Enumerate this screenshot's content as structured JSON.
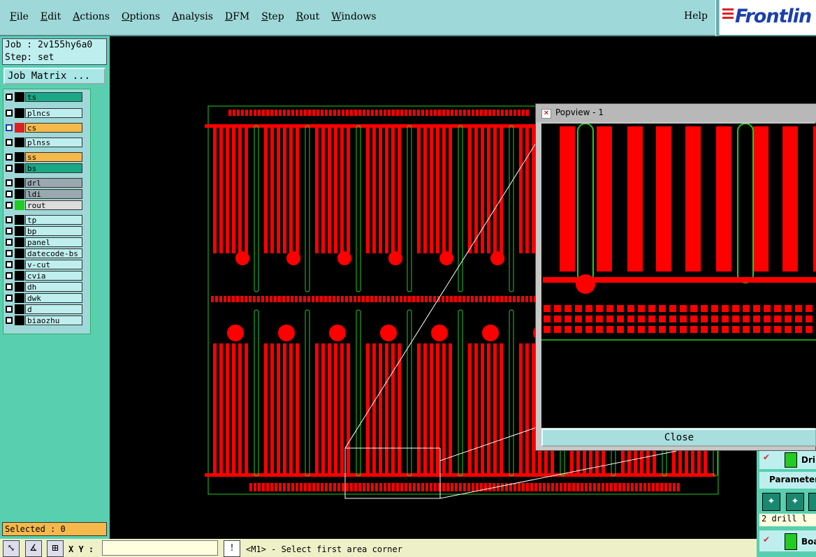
{
  "menu": {
    "items": [
      "File",
      "Edit",
      "Actions",
      "Options",
      "Analysis",
      "DFM",
      "Step",
      "Rout",
      "Windows"
    ],
    "help": "Help"
  },
  "logo": {
    "text": "Frontlin"
  },
  "job": {
    "job_line": "Job : 2v155hy6a0",
    "step_line": "Step: set",
    "matrix_button": "Job Matrix ..."
  },
  "layers": [
    {
      "name": "ts",
      "bg": "#1aa886",
      "swatch": "#000"
    },
    {
      "name": "plncs",
      "bg": "#bfeeee",
      "swatch": "#000"
    },
    {
      "name": "cs",
      "bg": "#f5b84a",
      "swatch": "#e02020",
      "active": true
    },
    {
      "name": "plnss",
      "bg": "#bfeeee",
      "swatch": "#000"
    },
    {
      "name": "ss",
      "bg": "#f5b84a",
      "swatch": "#000"
    },
    {
      "name": "bs",
      "bg": "#1aa886",
      "swatch": "#000"
    },
    {
      "name": "drl",
      "bg": "#9aa8b0",
      "swatch": "#000"
    },
    {
      "name": "ldi",
      "bg": "#9aa8b0",
      "swatch": "#000"
    },
    {
      "name": "rout",
      "bg": "#dcdcdc",
      "swatch": "#22cc22"
    },
    {
      "name": "tp",
      "bg": "#bfeeee",
      "swatch": "#000"
    },
    {
      "name": "bp",
      "bg": "#bfeeee",
      "swatch": "#000"
    },
    {
      "name": "panel",
      "bg": "#bfeeee",
      "swatch": "#000"
    },
    {
      "name": "datecode-bs",
      "bg": "#bfeeee",
      "swatch": "#000"
    },
    {
      "name": "v-cut",
      "bg": "#bfeeee",
      "swatch": "#000"
    },
    {
      "name": "cvia",
      "bg": "#bfeeee",
      "swatch": "#000"
    },
    {
      "name": "dh",
      "bg": "#bfeeee",
      "swatch": "#000"
    },
    {
      "name": "dwk",
      "bg": "#bfeeee",
      "swatch": "#000"
    },
    {
      "name": "d",
      "bg": "#bfeeee",
      "swatch": "#000"
    },
    {
      "name": "biaozhu",
      "bg": "#bfeeee",
      "swatch": "#000"
    }
  ],
  "selected": "Selected : 0",
  "status": {
    "xy_label": "X Y :",
    "message": "<M1> - Select first area corner"
  },
  "popview": {
    "title": "Popview - 1",
    "close": "Close"
  },
  "right_panel": {
    "dri": "Dri",
    "parameter": "Parameter",
    "drill": "2 drill l",
    "boa": "Boa"
  },
  "colors": {
    "copper": "#ff0000",
    "outline": "#22cc22",
    "accent": "#58d0b0"
  }
}
